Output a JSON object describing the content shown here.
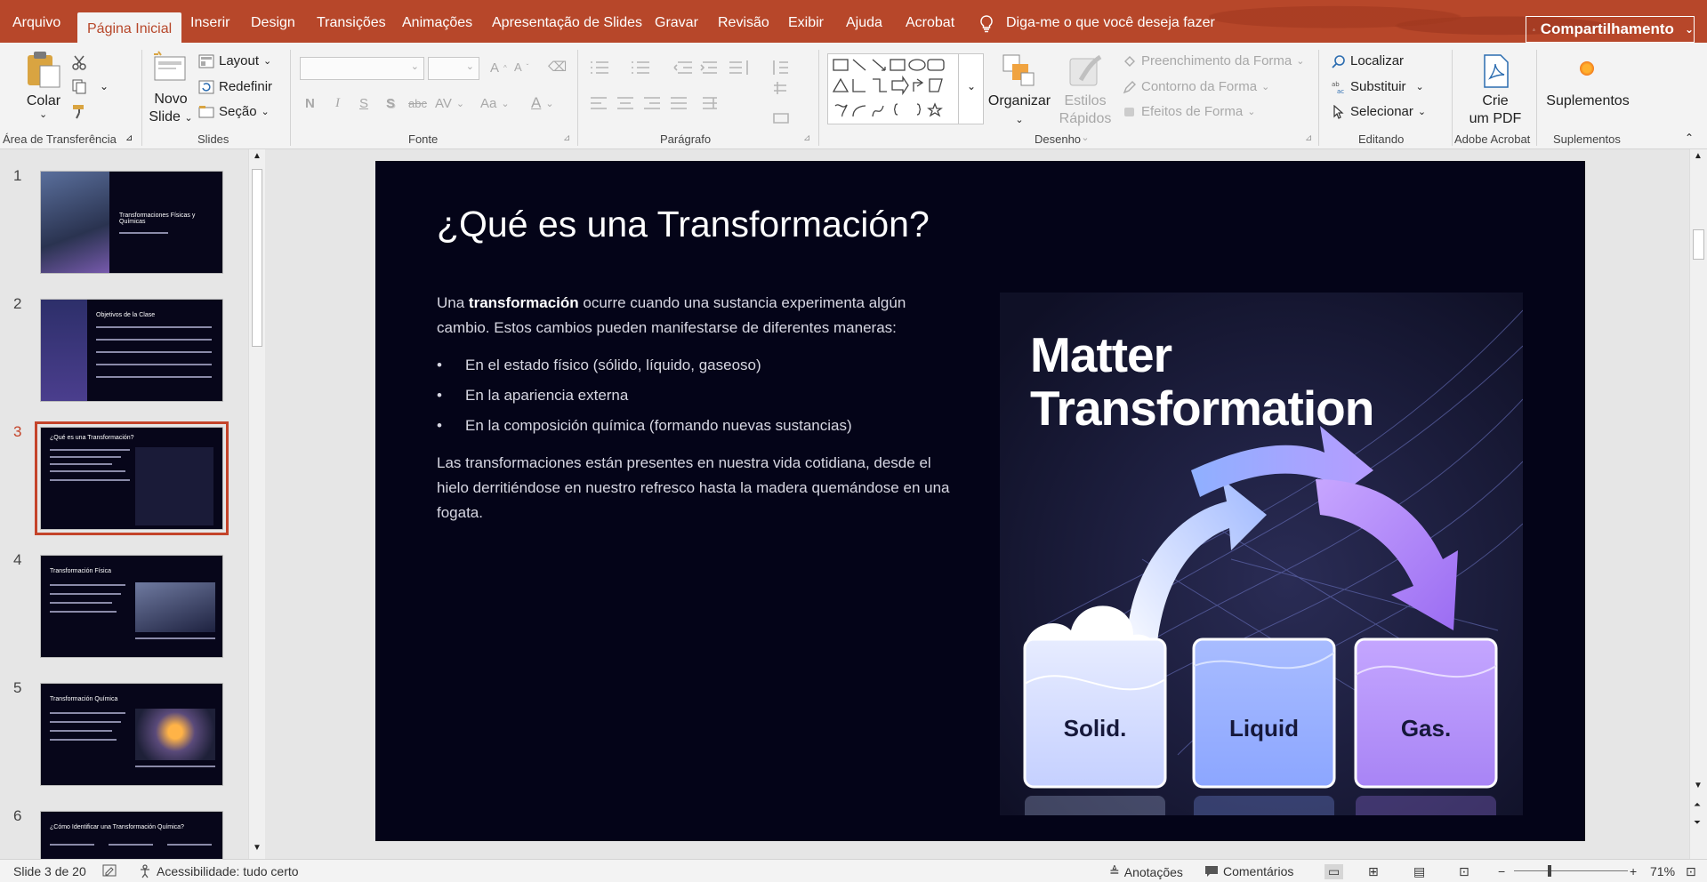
{
  "ribbon_tabs": [
    "Arquivo",
    "Página Inicial",
    "Inserir",
    "Design",
    "Transições",
    "Animações",
    "Apresentação de Slides",
    "Gravar",
    "Revisão",
    "Exibir",
    "Ajuda",
    "Acrobat"
  ],
  "tell_me": "Diga-me o que você deseja fazer",
  "share_label": "Compartilhamento",
  "clipboard": {
    "paste": "Colar",
    "label": "Área de Transferência"
  },
  "slides_group": {
    "new_slide_1": "Novo",
    "new_slide_2": "Slide",
    "layout": "Layout",
    "reset": "Redefinir",
    "section": "Seção",
    "label": "Slides"
  },
  "font_group": {
    "label": "Fonte",
    "bold": "N",
    "italic": "I",
    "underline": "S",
    "shadow": "S",
    "strike": "abc",
    "spacing": "AV",
    "case": "Aa",
    "grow": "A",
    "shrink": "A"
  },
  "paragraph_group": {
    "label": "Parágrafo"
  },
  "drawing_group": {
    "label": "Desenho",
    "arrange": "Organizar",
    "quick_styles_1": "Estilos",
    "quick_styles_2": "Rápidos",
    "fill": "Preenchimento da Forma",
    "outline": "Contorno da Forma",
    "effects": "Efeitos de Forma"
  },
  "editing_group": {
    "label": "Editando",
    "find": "Localizar",
    "replace": "Substituir",
    "select": "Selecionar"
  },
  "acrobat_group": {
    "label": "Adobe Acrobat",
    "create_1": "Crie",
    "create_2": "um PDF"
  },
  "addins_group": {
    "label": "Suplementos",
    "addins": "Suplementos"
  },
  "thumbnails": [
    {
      "number": "1",
      "title": "Transformaciones Físicas y Químicas"
    },
    {
      "number": "2",
      "title": "Objetivos de la Clase"
    },
    {
      "number": "3",
      "title": "¿Qué es una Transformación?"
    },
    {
      "number": "4",
      "title": "Transformación Física"
    },
    {
      "number": "5",
      "title": "Transformación Química"
    },
    {
      "number": "6",
      "title": "¿Cómo Identificar una Transformación Química?"
    }
  ],
  "slide": {
    "title": "¿Qué es una Transformación?",
    "intro_pre": "Una ",
    "intro_bold": "transformación",
    "intro_post": " ocurre cuando una sustancia experimenta algún cambio. Estos cambios pueden manifestarse de diferentes maneras:",
    "bullets": [
      "En el estado físico (sólido, líquido, gaseoso)",
      "En la apariencia externa",
      "En la composición química (formando nuevas sustancias)"
    ],
    "closing": "Las transformaciones están presentes en nuestra vida cotidiana, desde el hielo derritiéndose en nuestro refresco hasta la madera quemándose en una fogata.",
    "image": {
      "title_1": "Matter",
      "title_2": "Transformation",
      "labels": [
        "Solid.",
        "Liquid",
        "Gas."
      ]
    }
  },
  "status": {
    "slide_count": "Slide 3 de 20",
    "accessibility": "Acessibilidade: tudo certo",
    "notes": "Anotações",
    "comments": "Comentários",
    "zoom": "71%"
  }
}
